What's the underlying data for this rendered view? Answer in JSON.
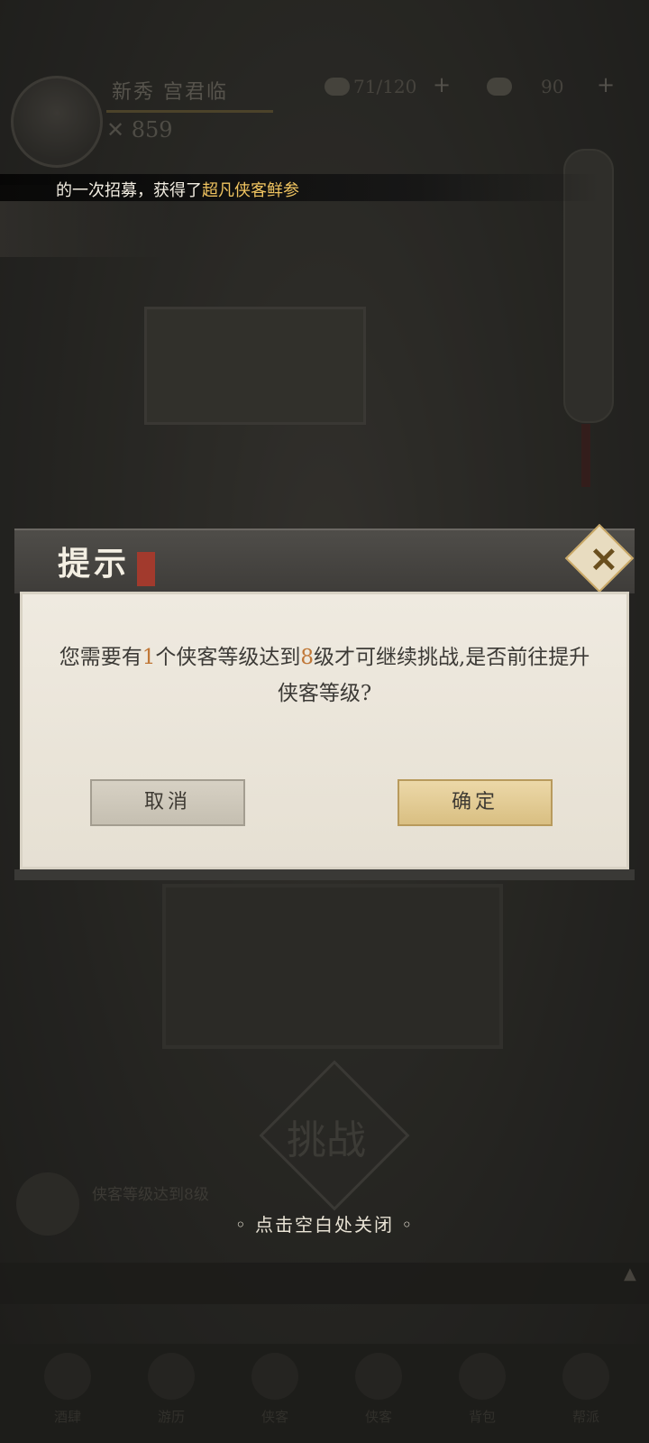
{
  "player": {
    "name": "新秀 宫君临",
    "power": "859"
  },
  "resources": [
    {
      "icon": "stamina-icon",
      "value": "71/120"
    },
    {
      "icon": "ingot-icon",
      "value": "90"
    }
  ],
  "banner": {
    "prefix": "的一次招募，获得了",
    "highlight": "超凡侠客鲜参"
  },
  "dialog": {
    "title": "提示",
    "message_parts": [
      "您需要有",
      "1",
      "个侠客等级达到",
      "8",
      "级才可继续挑战,是否前往提升侠客等级?"
    ],
    "cancel_label": "取消",
    "confirm_label": "确定"
  },
  "background": {
    "task_line": "侠客等级达到8级",
    "challenge_label": "挑战"
  },
  "close_hint": "点击空白处关闭",
  "nav": [
    {
      "icon": "home-icon",
      "label": "酒肆"
    },
    {
      "icon": "book-icon",
      "label": "游历"
    },
    {
      "icon": "sword-icon",
      "label": "侠客"
    },
    {
      "icon": "fan-icon",
      "label": "侠客"
    },
    {
      "icon": "bag-icon",
      "label": "背包"
    },
    {
      "icon": "scroll-icon",
      "label": "帮派"
    }
  ],
  "colors": {
    "accent": "#c07838",
    "highlight": "#f0c460"
  }
}
